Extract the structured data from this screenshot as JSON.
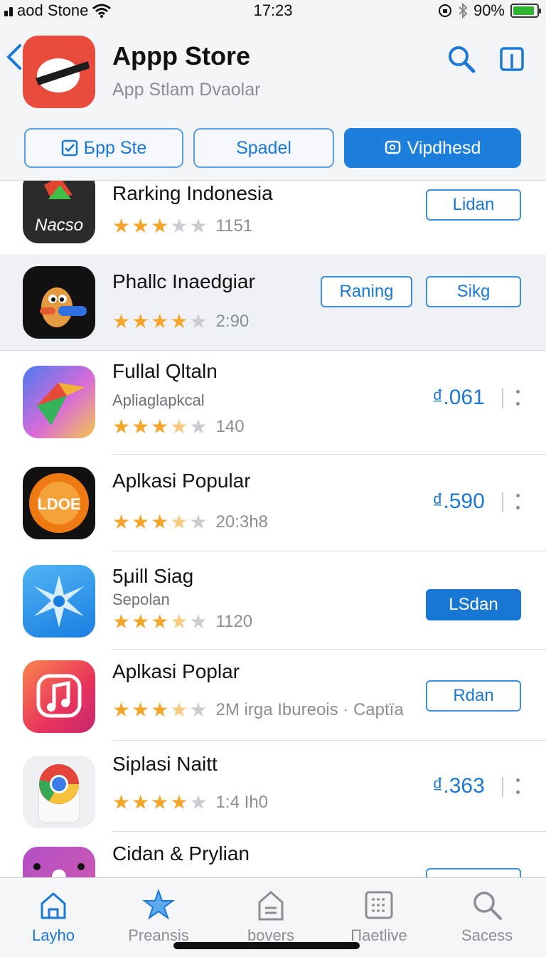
{
  "status_bar": {
    "carrier": "aod Stone",
    "time": "17:23",
    "battery": "90%"
  },
  "header": {
    "title": "Appp Store",
    "subtitle": "App Stlam Dvaolar",
    "segments": [
      {
        "label": "Бpp Ste",
        "active": false
      },
      {
        "label": "Spadel",
        "active": false
      },
      {
        "label": "Vipdhesd",
        "active": true
      }
    ]
  },
  "apps": [
    {
      "title": "Rarking Indonesia",
      "icon_text": "Nacso",
      "stars": 3,
      "rating_text": "1151",
      "button": "Lidan"
    },
    {
      "title": "Phallc Inaedgiar",
      "stars": 4,
      "rating_text": "2:90",
      "button_secondary": "Raning",
      "button": "Sikg"
    },
    {
      "title": "Fullal Qltaln",
      "subtitle": "Apliaglapkcal",
      "stars": 3.5,
      "rating_text": "140",
      "price": "₫.061"
    },
    {
      "title": "Aplkasi Popular",
      "icon_text": "LDOE",
      "stars": 3.5,
      "rating_text": "20:3h8",
      "price": "₫.590"
    },
    {
      "title": "5μill Siag",
      "subtitle": "Sepolan",
      "stars": 3.5,
      "rating_text": "1120",
      "button": "LSdan"
    },
    {
      "title": "Aplkasi Poplar",
      "stars": 3.5,
      "rating_text": "2M irga Ibureois · Captïa",
      "button": "Rdan"
    },
    {
      "title": "Siplasi Naitt",
      "stars": 4,
      "rating_text": "1:4 Ih0",
      "price": "₫.363"
    },
    {
      "title": "Cidan & Prylian"
    }
  ],
  "tabs": [
    {
      "label": "Layho",
      "active": true
    },
    {
      "label": "Preansis",
      "active": false
    },
    {
      "label": "bovers",
      "active": false
    },
    {
      "label": "Пaetlive",
      "active": false
    },
    {
      "label": "Sacess",
      "active": false
    }
  ],
  "colors": {
    "accent": "#1d7fdc",
    "star": "#f4a62a",
    "header_icon": "#e94c3d"
  }
}
